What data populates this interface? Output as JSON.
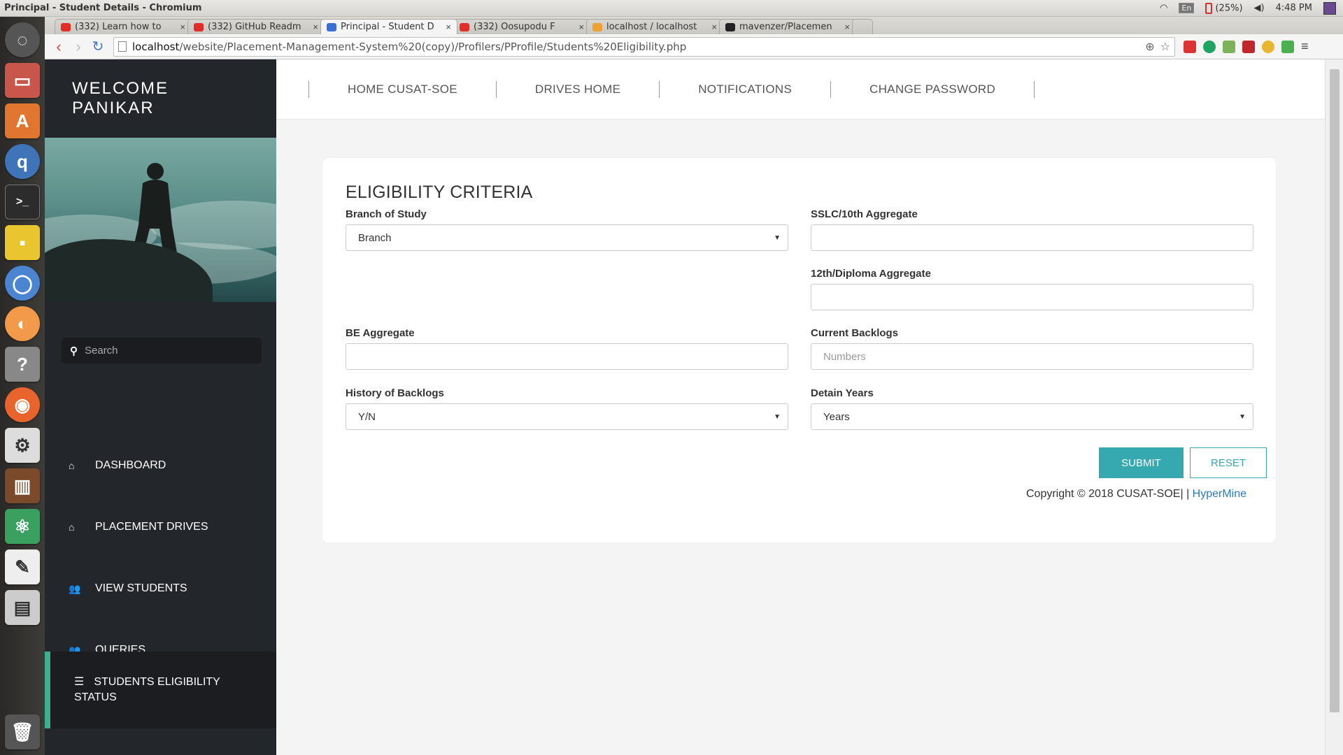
{
  "os": {
    "window_title": "Principal - Student Details - Chromium",
    "lang": "En",
    "battery": "(25%)",
    "time": "4:48 PM"
  },
  "browser": {
    "tabs": [
      {
        "label": "(332) Learn how to",
        "favicon_color": "#e52d27"
      },
      {
        "label": "(332) GitHub Readm",
        "favicon_color": "#e52d27"
      },
      {
        "label": "Principal - Student D",
        "favicon_color": "#3b6fd4"
      },
      {
        "label": "(332) Oosupodu F",
        "favicon_color": "#e52d27"
      },
      {
        "label": "localhost / localhost",
        "favicon_color": "#f0a030"
      },
      {
        "label": "mavenzer/Placemen",
        "favicon_color": "#222222"
      }
    ],
    "url_host": "localhost",
    "url_path": "/website/Placement-Management-System%20(copy)/Profilers/PProfile/Students%20Eligibility.php"
  },
  "sidebar": {
    "welcome_line1": "WELCOME",
    "welcome_line2": "PANIKAR",
    "search_placeholder": "Search",
    "items": [
      {
        "label": "DASHBOARD",
        "icon": "home-icon"
      },
      {
        "label": "PLACEMENT DRIVES",
        "icon": "home-icon"
      },
      {
        "label": "VIEW STUDENTS",
        "icon": "users-icon"
      },
      {
        "label": "QUERIES",
        "icon": "users-icon"
      },
      {
        "label_line1": "STUDENTS ELIGIBILITY",
        "label_line2": "STATUS",
        "icon": "sliders-icon"
      }
    ]
  },
  "topnav": {
    "items": [
      "HOME CUSAT-SOE",
      "DRIVES HOME",
      "NOTIFICATIONS",
      "CHANGE PASSWORD"
    ]
  },
  "form": {
    "title": "ELIGIBILITY CRITERIA",
    "branch_label": "Branch of Study",
    "branch_value": "Branch",
    "sslc_label": "SSLC/10th Aggregate",
    "sslc_value": "",
    "twelfth_label": "12th/Diploma Aggregate",
    "twelfth_value": "",
    "be_label": "BE Aggregate",
    "be_value": "",
    "backlogs_label": "Current Backlogs",
    "backlogs_placeholder": "Numbers",
    "history_label": "History of Backlogs",
    "history_value": "Y/N",
    "detain_label": "Detain Years",
    "detain_value": "Years",
    "submit_label": "SUBMIT",
    "reset_label": "RESET",
    "copyright": "Copyright © 2018 CUSAT-SOE| | ",
    "copyright_link": "HyperMine"
  },
  "colors": {
    "sidebar_bg": "#23262a",
    "accent_green": "#3ab08e",
    "submit_teal": "#36a8b0",
    "link_blue": "#2a7bbf"
  }
}
